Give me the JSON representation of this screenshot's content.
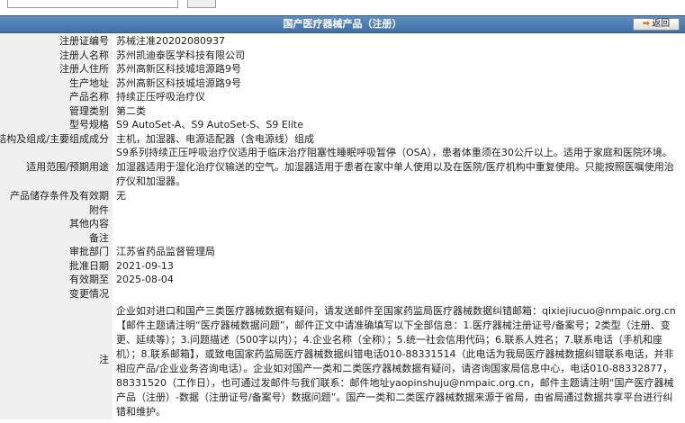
{
  "header": {
    "title": "国产医疗器械产品（注册）",
    "back_label": "返回"
  },
  "rows": {
    "reg_no": {
      "label": "注册证编号",
      "value": "苏械注准20202080937"
    },
    "registrant": {
      "label": "注册人名称",
      "value": "苏州凯迪泰医学科技有限公司"
    },
    "reg_addr": {
      "label": "注册人住所",
      "value": "苏州高新区科技城培源路9号"
    },
    "prod_addr": {
      "label": "生产地址",
      "value": "苏州高新区科技城培源路9号"
    },
    "product": {
      "label": "产品名称",
      "value": "持续正压呼吸治疗仪"
    },
    "category": {
      "label": "管理类别",
      "value": "第二类"
    },
    "model": {
      "label": "型号规格",
      "value": "S9 AutoSet-A、S9 AutoSet-S、S9 Elite"
    },
    "structure": {
      "label": "结构及组成/主要组成成分",
      "value": "主机，加湿器、电源适配器（含电源线）组成"
    },
    "scope": {
      "label": "适用范围/预期用途",
      "value": "S9系列持续正压呼吸治疗仪适用于临床治疗阻塞性睡眠呼吸暂停（OSA），患者体重须在30公斤以上。适用于家庭和医院环境。加湿器适用于湿化治疗仪输送的空气。加湿器适用于患者在家中单人使用以及在医院/医疗机构中重复使用。只能按照医嘱使用治疗仪和加湿器。"
    },
    "storage": {
      "label": "产品储存条件及有效期",
      "value": "无"
    },
    "attachment": {
      "label": "附件",
      "value": ""
    },
    "other": {
      "label": "其他内容",
      "value": ""
    },
    "remark": {
      "label": "备注",
      "value": ""
    },
    "dept": {
      "label": "审批部门",
      "value": "江苏省药品监督管理局"
    },
    "approve_date": {
      "label": "批准日期",
      "value": "2021-09-13"
    },
    "expire_date": {
      "label": "有效期至",
      "value": "2025-08-04"
    },
    "changes": {
      "label": "变更情况",
      "value": ""
    },
    "note": {
      "label": "注",
      "value": "企业如对进口和国产三类医疗器械数据有疑问，请发送邮件至国家药监局医疗器械数据纠错邮箱：qixiejiucuo@nmpaic.org.cn【邮件主题请注明“医疗器械数据问题”，邮件正文中请准确填写以下全部信息：1.医疗器械注册证号/备案号；2类型（注册、变更、延续等）；3.问题描述（500字以内）；4.企业名称（全称）；5.统一社会信用代码；6.联系人姓名；7.联系电话（手机和座机）；8.联系邮箱】，或致电国家药监局医疗器械数据纠错电话010-88331514（此电话为我局医疗器械数据纠错联系电话，并非相应产品/企业业务咨询电话）。企业如对国产一类和二类医疗器械数据有疑问，请咨询国家局信息中心，电话010-88332877，88331520（工作日），也可通过发邮件与我们联系：邮件地址yaopinshuju@nmpaic.org.cn，邮件主题请注明“国产医疗器械产品（注册）-数据（注册证号/备案号）数据问题”。国产一类和二类医疗器械数据来源于省局，由省局通过数据共享平台进行纠错和维护。"
    }
  }
}
